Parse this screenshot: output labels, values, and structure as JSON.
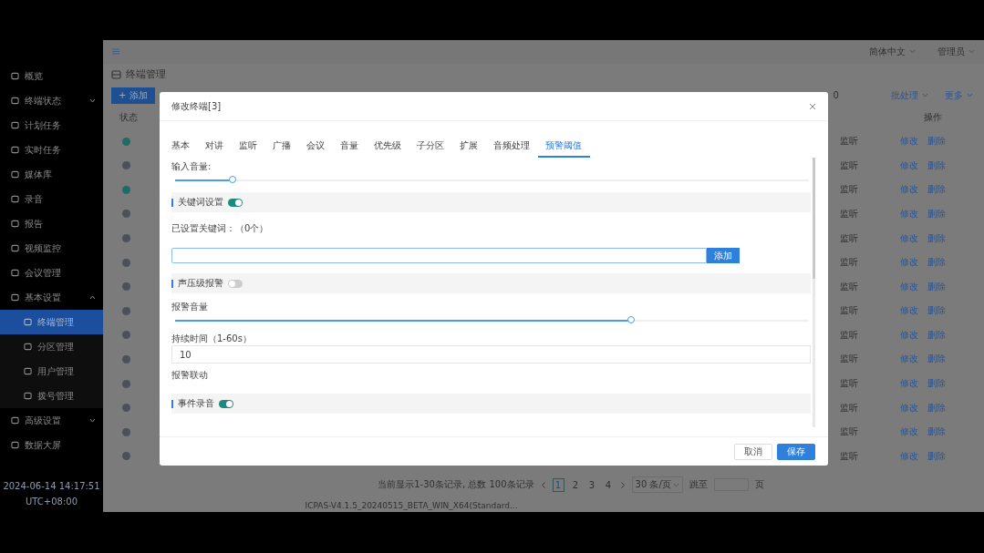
{
  "header": {
    "language": "简体中文",
    "user": "管理员"
  },
  "sidebar": {
    "items": [
      {
        "label": "概览",
        "selected": false
      },
      {
        "label": "终端状态",
        "selected": false,
        "expanded": false
      },
      {
        "label": "计划任务",
        "selected": false
      },
      {
        "label": "实时任务",
        "selected": false
      },
      {
        "label": "媒体库",
        "selected": false
      },
      {
        "label": "录音",
        "selected": false
      },
      {
        "label": "报告",
        "selected": false
      },
      {
        "label": "视频监控",
        "selected": false
      },
      {
        "label": "会议管理",
        "selected": false
      },
      {
        "label": "基本设置",
        "selected": false,
        "expanded": true,
        "children": [
          {
            "label": "终端管理",
            "selected": true
          },
          {
            "label": "分区管理",
            "selected": false
          },
          {
            "label": "用户管理",
            "selected": false
          },
          {
            "label": "拨号管理",
            "selected": false
          }
        ]
      },
      {
        "label": "高级设置",
        "selected": false,
        "expanded": false
      },
      {
        "label": "数据大屏",
        "selected": false
      }
    ],
    "clock": {
      "time": "2024-06-14 14:17:51",
      "timezone": "UTC+08:00"
    }
  },
  "page": {
    "title": "终端管理",
    "add_button": "+ 添加",
    "column_3_partial": "0",
    "batch_menu": "批处理",
    "more_menu": "更多"
  },
  "table": {
    "columns": [
      "状态",
      "操作"
    ],
    "rows": [
      {
        "color": "#1f6b66",
        "column_3": "监听",
        "actions": [
          "修改",
          "删除"
        ]
      },
      {
        "color": "#4b5059",
        "column_3": "监听",
        "actions": [
          "修改",
          "删除"
        ]
      },
      {
        "color": "#1f6b66",
        "column_3": "监听",
        "actions": [
          "修改",
          "删除"
        ]
      },
      {
        "color": "#4b5059",
        "column_3": "监听",
        "actions": [
          "修改",
          "删除"
        ]
      },
      {
        "color": "#4b5059",
        "column_3": "监听",
        "actions": [
          "修改",
          "删除"
        ]
      },
      {
        "color": "#4b5059",
        "column_3": "监听",
        "actions": [
          "修改",
          "删除"
        ]
      },
      {
        "color": "#4b5059",
        "column_3": "监听",
        "actions": [
          "修改",
          "删除"
        ]
      },
      {
        "color": "#4b5059",
        "column_3": "监听",
        "actions": [
          "修改",
          "删除"
        ]
      },
      {
        "color": "#4b5059",
        "column_3": "监听",
        "actions": [
          "修改",
          "删除"
        ]
      },
      {
        "color": "#4b5059",
        "column_3": "监听",
        "actions": [
          "修改",
          "删除"
        ]
      },
      {
        "color": "#4b5059",
        "column_3": "监听",
        "actions": [
          "修改",
          "删除"
        ]
      },
      {
        "color": "#4b5059",
        "column_3": "监听",
        "actions": [
          "修改",
          "删除"
        ]
      },
      {
        "color": "#4b5059",
        "column_3": "监听",
        "actions": [
          "修改",
          "删除"
        ]
      },
      {
        "color": "#4b5059",
        "column_3": "监听",
        "actions": [
          "修改",
          "删除"
        ]
      }
    ]
  },
  "pagination": {
    "summary": "当前显示1-30条记录, 总数 100条记录",
    "pages": [
      {
        "label": "1",
        "selected": true
      },
      {
        "label": "2",
        "selected": false
      },
      {
        "label": "3",
        "selected": false
      },
      {
        "label": "4",
        "selected": false
      }
    ],
    "page_size": "30 条/页",
    "jump_label": "跳至",
    "page_suffix": "页"
  },
  "version": "ICPAS-V4.1.5_20240515_BETA_WIN_X64(Standard...",
  "dialog": {
    "title": "修改终端[3]",
    "tabs": [
      {
        "label": "基本",
        "selected": false
      },
      {
        "label": "对讲",
        "selected": false
      },
      {
        "label": "监听",
        "selected": false
      },
      {
        "label": "广播",
        "selected": false
      },
      {
        "label": "会议",
        "selected": false
      },
      {
        "label": "音量",
        "selected": false
      },
      {
        "label": "优先级",
        "selected": false
      },
      {
        "label": "子分区",
        "selected": false
      },
      {
        "label": "扩展",
        "selected": false
      },
      {
        "label": "音频处理",
        "selected": false
      },
      {
        "label": "预警阈值",
        "selected": true
      }
    ],
    "fields": [
      {
        "kind": "slider",
        "label": "输入音量:",
        "level": 0.09
      },
      {
        "kind": "section",
        "label": "关键词设置",
        "on": true
      },
      {
        "kind": "text",
        "label": "已设置关键词：（0个）"
      },
      {
        "kind": "add",
        "button": "添加"
      },
      {
        "kind": "section",
        "label": "声压级报警",
        "on": false
      },
      {
        "kind": "slider",
        "label": "报警音量",
        "level": 0.72
      },
      {
        "kind": "input",
        "label": "持续时间（1-60s）",
        "value": "10"
      },
      {
        "kind": "text",
        "label": "报警联动"
      },
      {
        "kind": "section",
        "label": "事件录音",
        "on": true
      }
    ],
    "buttons": [
      {
        "label": "取消",
        "kind": "secondary"
      },
      {
        "label": "保存",
        "kind": "primary"
      }
    ]
  }
}
